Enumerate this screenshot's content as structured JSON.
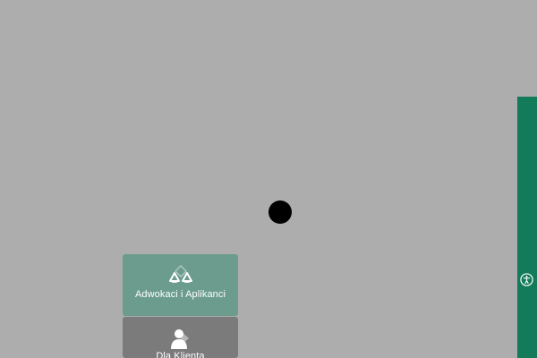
{
  "menu": {
    "lawyers_label": "Adwokaci i Aplikanci",
    "client_label": "Dla Klienta"
  },
  "icons": {
    "loader": "loading-dot",
    "lawyers": "scales-of-justice-icon",
    "client": "client-user-icon",
    "accessibility": "accessibility-icon"
  },
  "colors": {
    "background": "#adadad",
    "accent": "#137a5a",
    "lawyers_tile": "#6b9c8d",
    "client_tile": "#7b7b7b"
  }
}
